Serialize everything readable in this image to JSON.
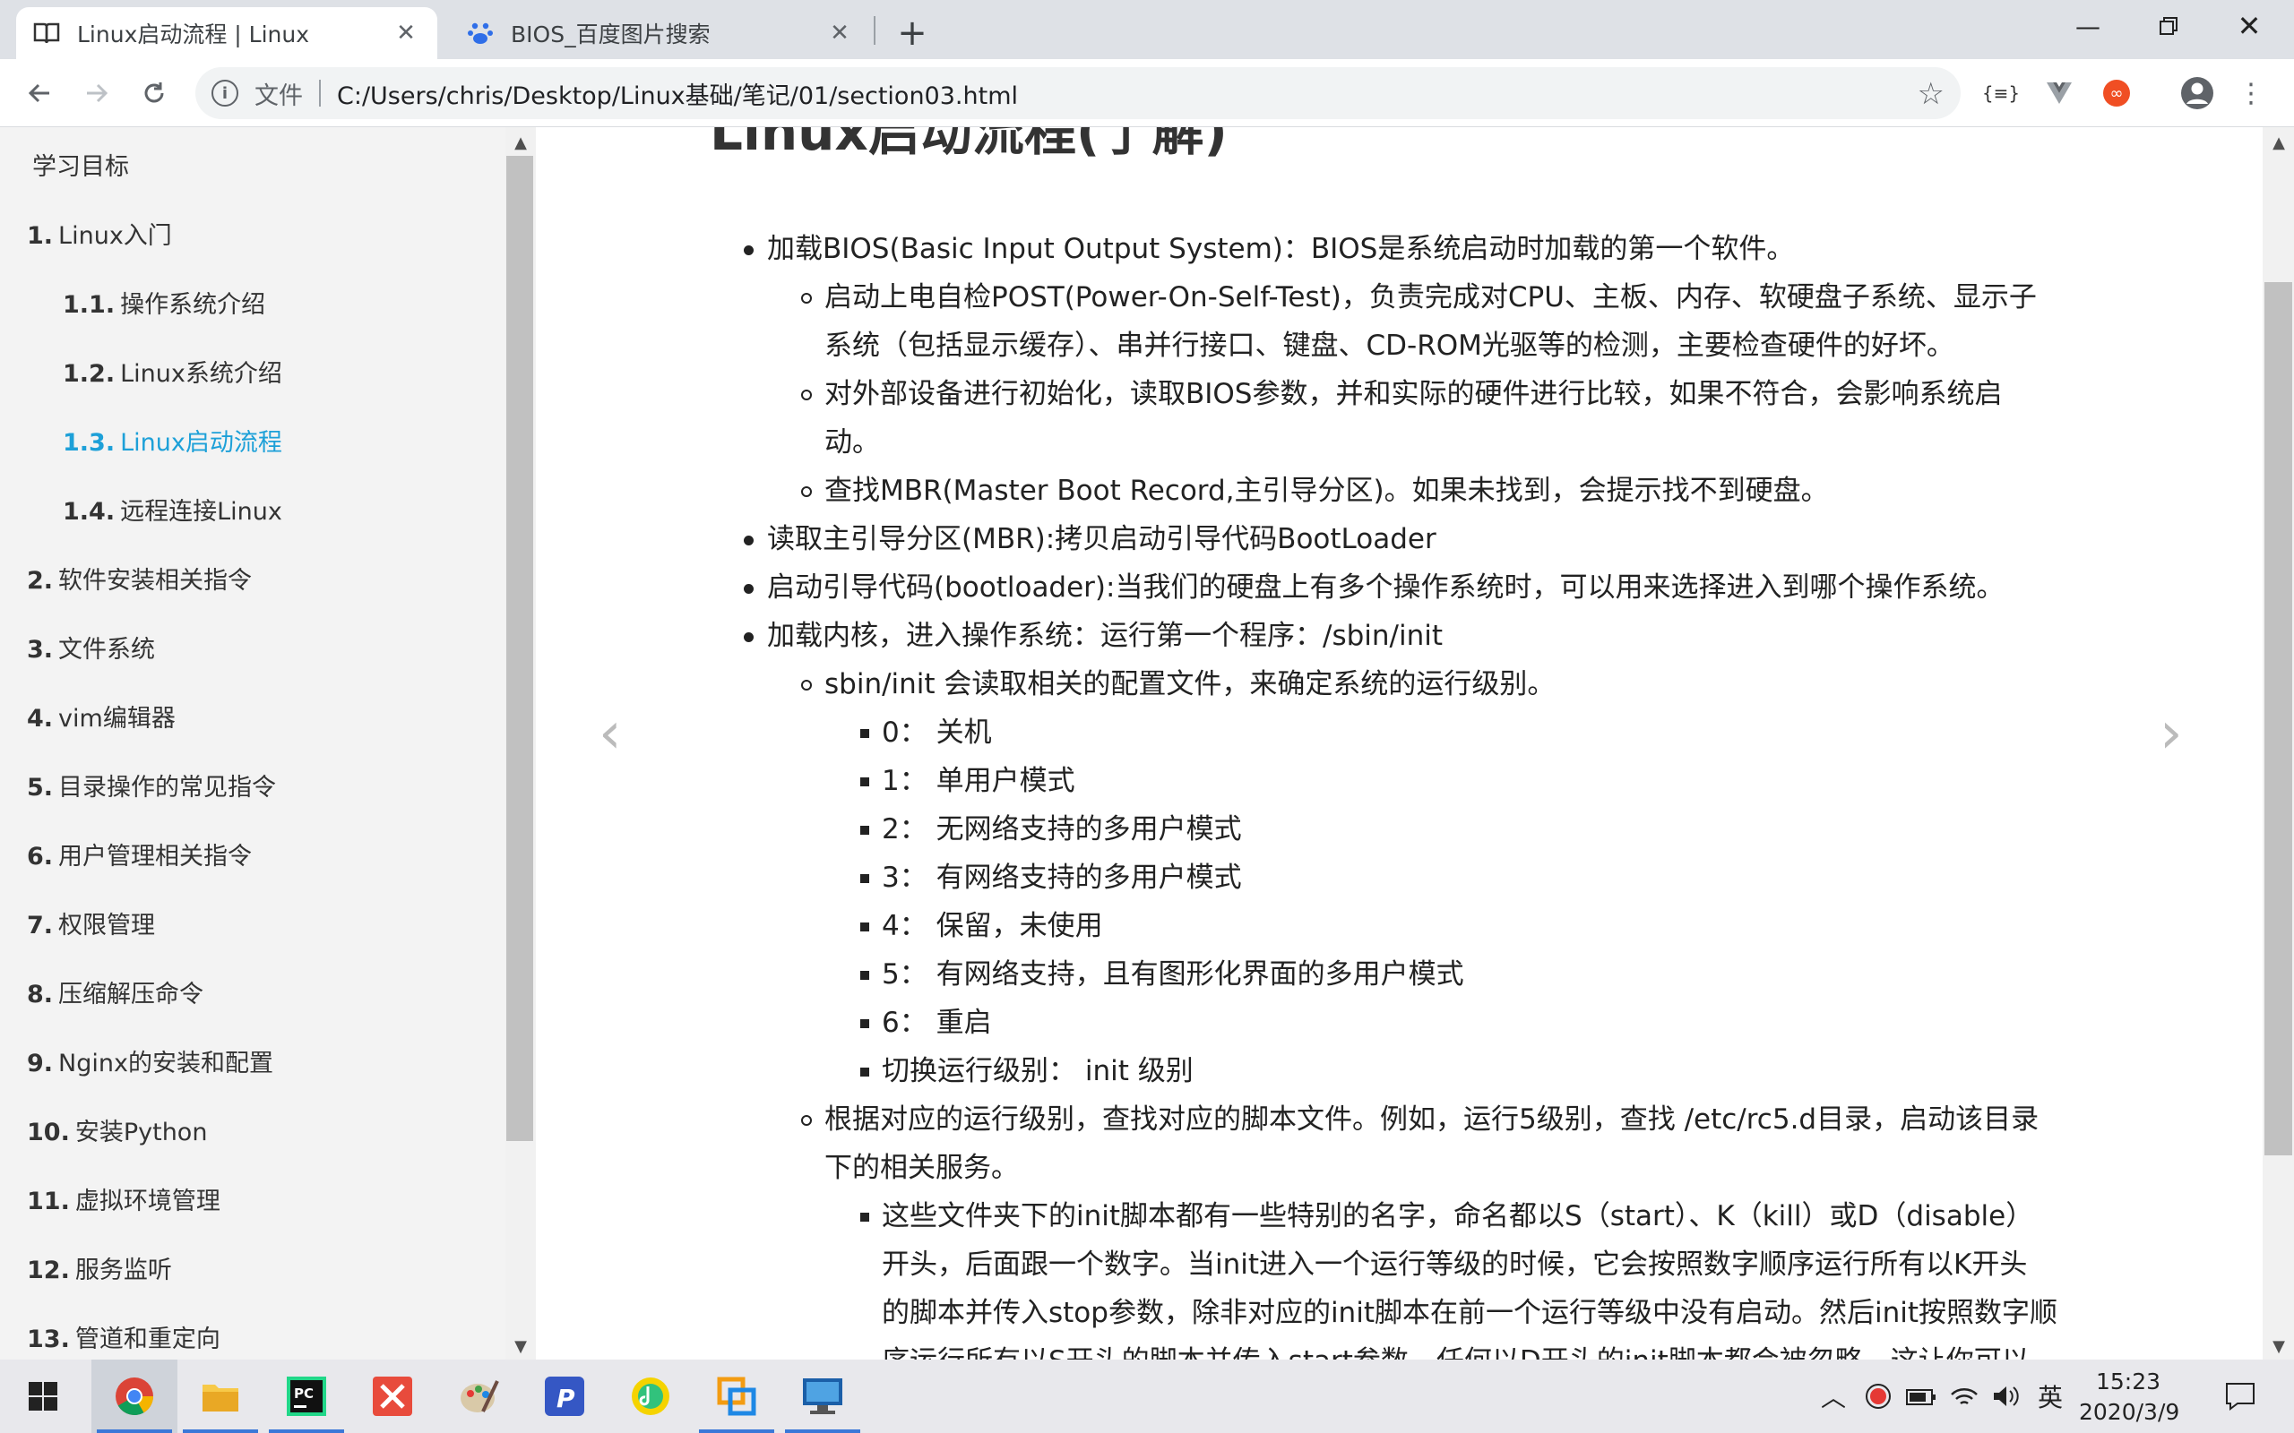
{
  "browser": {
    "tabs": [
      {
        "title": "Linux启动流程 | Linux",
        "active": true,
        "icon": "book-icon"
      },
      {
        "title": "BIOS_百度图片搜索",
        "active": false,
        "icon": "baidu-paw-icon"
      }
    ],
    "address_scheme": "文件",
    "url": "C:/Users/chris/Desktop/Linux基础/笔记/01/section03.html"
  },
  "sidebar": {
    "items": [
      {
        "num": "",
        "label": "学习目标",
        "level": 1,
        "active": false
      },
      {
        "num": "1.",
        "label": "Linux入门",
        "level": 1,
        "active": false
      },
      {
        "num": "1.1.",
        "label": "操作系统介绍",
        "level": 2,
        "active": false
      },
      {
        "num": "1.2.",
        "label": "Linux系统介绍",
        "level": 2,
        "active": false
      },
      {
        "num": "1.3.",
        "label": "Linux启动流程",
        "level": 2,
        "active": true
      },
      {
        "num": "1.4.",
        "label": "远程连接Linux",
        "level": 2,
        "active": false
      },
      {
        "num": "2.",
        "label": "软件安装相关指令",
        "level": 1,
        "active": false
      },
      {
        "num": "3.",
        "label": "文件系统",
        "level": 1,
        "active": false
      },
      {
        "num": "4.",
        "label": "vim编辑器",
        "level": 1,
        "active": false
      },
      {
        "num": "5.",
        "label": "目录操作的常见指令",
        "level": 1,
        "active": false
      },
      {
        "num": "6.",
        "label": "用户管理相关指令",
        "level": 1,
        "active": false
      },
      {
        "num": "7.",
        "label": "权限管理",
        "level": 1,
        "active": false
      },
      {
        "num": "8.",
        "label": "压缩解压命令",
        "level": 1,
        "active": false
      },
      {
        "num": "9.",
        "label": "Nginx的安装和配置",
        "level": 1,
        "active": false
      },
      {
        "num": "10.",
        "label": "安装Python",
        "level": 1,
        "active": false
      },
      {
        "num": "11.",
        "label": "虚拟环境管理",
        "level": 1,
        "active": false
      },
      {
        "num": "12.",
        "label": "服务监听",
        "level": 1,
        "active": false
      },
      {
        "num": "13.",
        "label": "管道和重定向",
        "level": 1,
        "active": false
      }
    ]
  },
  "content": {
    "heading": "Linux启动流程(了解)",
    "lines": [
      {
        "bullet": "disc",
        "text": "加载BIOS(Basic Input Output System)：BIOS是系统启动时加载的第一个软件。"
      },
      {
        "bullet": "circle",
        "text": "启动上电自检POST(Power-On-Self-Test)，负责完成对CPU、主板、内存、软硬盘子系统、显示子"
      },
      {
        "bullet": "",
        "text": "系统（包括显示缓存）、串并行接口、键盘、CD-ROM光驱等的检测，主要检查硬件的好坏。"
      },
      {
        "bullet": "circle",
        "text": "对外部设备进行初始化，读取BIOS参数，并和实际的硬件进行比较，如果不符合，会影响系统启"
      },
      {
        "bullet": "",
        "text": "动。"
      },
      {
        "bullet": "circle",
        "text": "查找MBR(Master Boot Record,主引导分区)。如果未找到，会提示找不到硬盘。"
      },
      {
        "bullet": "disc",
        "text": "读取主引导分区(MBR):拷贝启动引导代码BootLoader"
      },
      {
        "bullet": "disc",
        "text": "启动引导代码(bootloader):当我们的硬盘上有多个操作系统时，可以用来选择进入到哪个操作系统。"
      },
      {
        "bullet": "disc",
        "text": "加载内核，进入操作系统：运行第一个程序：/sbin/init"
      },
      {
        "bullet": "circle",
        "text": "sbin/init 会读取相关的配置文件，来确定系统的运行级别。"
      },
      {
        "bullet": "square",
        "text": "0：  关机"
      },
      {
        "bullet": "square",
        "text": "1：  单用户模式"
      },
      {
        "bullet": "square",
        "text": "2：  无网络支持的多用户模式"
      },
      {
        "bullet": "square",
        "text": "3：  有网络支持的多用户模式"
      },
      {
        "bullet": "square",
        "text": "4：  保留，未使用"
      },
      {
        "bullet": "square",
        "text": "5：  有网络支持，且有图形化界面的多用户模式"
      },
      {
        "bullet": "square",
        "text": "6：  重启"
      },
      {
        "bullet": "square",
        "text": "切换运行级别：  init 级别"
      },
      {
        "bullet": "circle",
        "text": "根据对应的运行级别，查找对应的脚本文件。例如，运行5级别，查找 /etc/rc5.d目录，启动该目录"
      },
      {
        "bullet": "",
        "text": "下的相关服务。"
      },
      {
        "bullet": "square",
        "text": "这些文件夹下的init脚本都有一些特别的名字，命名都以S（start）、K（kill）或D（disable）"
      },
      {
        "bullet": "",
        "text": "开头，后面跟一个数字。当init进入一个运行等级的时候，它会按照数字顺序运行所有以K开头"
      },
      {
        "bullet": "",
        "text": "的脚本并传入stop参数，除非对应的init脚本在前一个运行等级中没有启动。然后init按照数字顺"
      },
      {
        "bullet": "",
        "text": "序运行所有以S开头的脚本并传入start参数。任何以D开头的init脚本都会被忽略，这让你可以"
      }
    ]
  },
  "taskbar": {
    "apps": [
      "windows-start-icon",
      "chrome-icon",
      "file-explorer-icon",
      "pycharm-icon",
      "xmind-icon",
      "paint-icon",
      "pdf-reader-icon",
      "music-icon",
      "virtualbox-icon",
      "remote-desktop-icon"
    ],
    "ime": "英",
    "time": "15:23",
    "date": "2020/3/9"
  }
}
